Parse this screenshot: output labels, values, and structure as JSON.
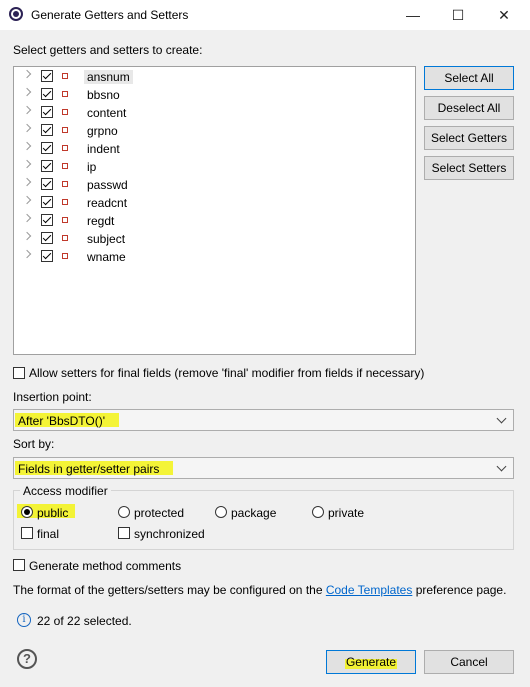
{
  "window": {
    "title": "Generate Getters and Setters",
    "minimize": "—",
    "maximize": "☐",
    "close": "✕"
  },
  "prompt": "Select getters and setters to create:",
  "fields": [
    "ansnum",
    "bbsno",
    "content",
    "grpno",
    "indent",
    "ip",
    "passwd",
    "readcnt",
    "regdt",
    "subject",
    "wname"
  ],
  "buttons": {
    "select_all": "Select All",
    "deselect_all": "Deselect All",
    "select_getters": "Select Getters",
    "select_setters": "Select Setters"
  },
  "allow_final": "Allow setters for final fields (remove 'final' modifier from fields if necessary)",
  "insertion": {
    "label": "Insertion point:",
    "value": "After 'BbsDTO()'"
  },
  "sort": {
    "label": "Sort by:",
    "value": "Fields in getter/setter pairs"
  },
  "access": {
    "title": "Access modifier",
    "public": "public",
    "protected": "protected",
    "package": "package",
    "private": "private",
    "final": "final",
    "synchronized": "synchronized"
  },
  "generate_comments": "Generate method comments",
  "format_note": {
    "before": "The format of the getters/setters may be configured on the",
    "link": "Code Templates",
    "after": "preference page."
  },
  "status": "22 of 22 selected.",
  "footer": {
    "generate": "Generate",
    "cancel": "Cancel"
  },
  "colors": {
    "highlight": "#f3f315",
    "link": "#0066cc"
  }
}
